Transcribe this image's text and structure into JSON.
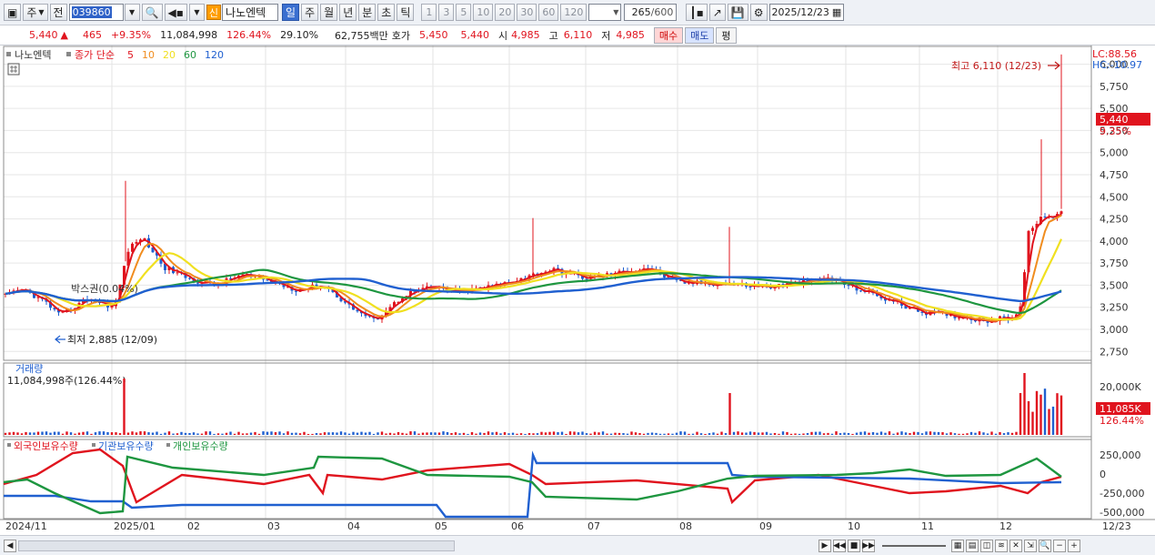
{
  "toolbar": {
    "mode_label": "주",
    "compare_label": "전",
    "stock_code": "039860",
    "shin_badge": "신",
    "stock_name": "나노엔텍",
    "periods": [
      "일",
      "주",
      "월",
      "년",
      "분",
      "초",
      "틱"
    ],
    "active_period": "일",
    "intervals": [
      "1",
      "3",
      "5",
      "10",
      "20",
      "30",
      "60",
      "120"
    ],
    "count_value": "265",
    "count_total": "/600",
    "date_value": "2025/12/23"
  },
  "quote": {
    "price": "5,440",
    "arrow": "▲",
    "change": "465",
    "change_pct": "+9.35%",
    "volume": "11,084,998",
    "volume_ratio": "126.44%",
    "turnover": "29.10%",
    "amount": "62,755백만",
    "hoga_label": "호가",
    "ask": "5,450",
    "bid": "5,440",
    "open_label": "시",
    "open": "4,985",
    "high_label": "고",
    "high": "6,110",
    "low_label": "저",
    "low": "4,985",
    "buy_label": "매수",
    "sell_label": "매도",
    "flat_label": "평"
  },
  "chart_data": {
    "type": "line",
    "legend": {
      "stock_tag": "나노엔텍",
      "ma_label": "종가 단순",
      "ma_periods": [
        "5",
        "10",
        "20",
        "60",
        "120"
      ],
      "ma_colors": [
        "#e0141e",
        "#f08c1e",
        "#f0e020",
        "#1e9640",
        "#2060d0"
      ]
    },
    "price_axis": {
      "ticks": [
        "6,000",
        "5,750",
        "5,500",
        "5,250",
        "5,000",
        "4,750",
        "4,500",
        "4,250",
        "4,000",
        "3,750",
        "3,500",
        "3,250",
        "3,000",
        "2,750"
      ],
      "range": [
        2650,
        6150
      ],
      "lc_label": "LC:88.56",
      "hc_label": "HC:-10.97",
      "current_price_tag": "5,440",
      "current_pct_tag": "9.35%"
    },
    "annotations": {
      "high": "최고 6,110 (12/23)",
      "low": "최저 2,885 (12/09)",
      "sideline": "박스권(0.04%)"
    },
    "volume": {
      "title": "거래량",
      "summary": "11,084,998주(126.44%)",
      "ticks": [
        "20,000K",
        "10,000K"
      ],
      "current_tag": "11,085K",
      "current_pct": "126.44%"
    },
    "holdings": {
      "series_names": [
        "외국인보유수량",
        "기관보유수량",
        "개인보유수량"
      ],
      "colors": [
        "#e0141e",
        "#2060d0",
        "#1e9640"
      ],
      "ticks": [
        "250,000",
        "0",
        "-250,000",
        "-500,000"
      ]
    },
    "x_labels": [
      "2024/11",
      "2025/01",
      "02",
      "03",
      "04",
      "05",
      "06",
      "07",
      "08",
      "09",
      "10",
      "11",
      "12"
    ],
    "x_label_last": "12/23"
  },
  "scrollbar": {
    "left_arrow": "◀",
    "right_arrow": "▶",
    "nav_buttons": [
      "◀◀",
      "■",
      "▶▶"
    ],
    "zoom_minus": "−",
    "zoom_plus": "+"
  }
}
